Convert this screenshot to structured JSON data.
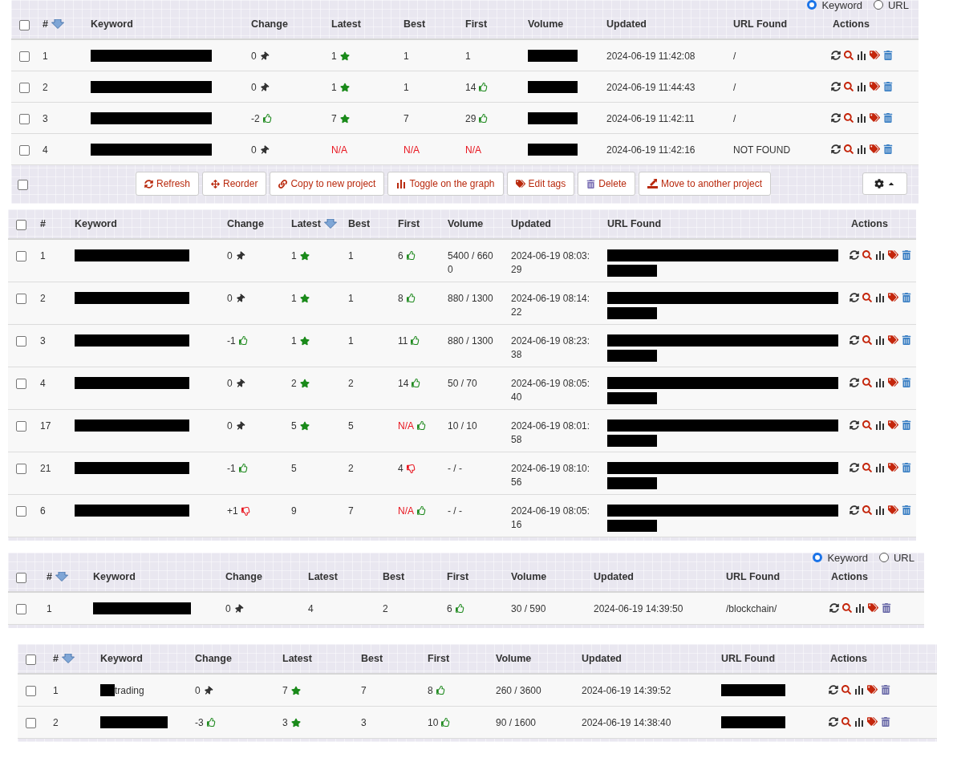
{
  "panels": [
    {
      "search_mode": [
        {
          "label": "Keyword",
          "selected": true
        },
        {
          "label": "URL",
          "selected": false
        }
      ],
      "all_checked": false,
      "columns": [
        {
          "label": "#",
          "sorted": true
        },
        {
          "label": "Keyword",
          "sorted": false
        },
        {
          "label": "Change",
          "sorted": false
        },
        {
          "label": "Latest",
          "sorted": false
        },
        {
          "label": "Best",
          "sorted": false
        },
        {
          "label": "First",
          "sorted": false
        },
        {
          "label": "Volume",
          "sorted": false
        },
        {
          "label": "Updated",
          "sorted": false
        },
        {
          "label": "URL Found",
          "sorted": false
        },
        {
          "label": "Actions",
          "sorted": false
        }
      ],
      "rows": [
        {
          "checked": false,
          "cells": [
            {
              "text": "1"
            },
            {
              "redacted": true
            },
            {
              "text": "0",
              "kind": "pin"
            },
            {
              "text": "1",
              "kind": "star"
            },
            {
              "text": "1"
            },
            {
              "text": "1"
            },
            {
              "redacted": true
            },
            {
              "text": "2024-06-19 11:42:08"
            },
            {
              "text": "/"
            }
          ]
        },
        {
          "checked": false,
          "cells": [
            {
              "text": "2"
            },
            {
              "redacted": true
            },
            {
              "text": "0",
              "kind": "pin"
            },
            {
              "text": "1",
              "kind": "star"
            },
            {
              "text": "1"
            },
            {
              "text": "14",
              "kind": "up"
            },
            {
              "redacted": true
            },
            {
              "text": "2024-06-19 11:44:43"
            },
            {
              "text": "/"
            }
          ]
        },
        {
          "checked": false,
          "cells": [
            {
              "text": "3"
            },
            {
              "redacted": true
            },
            {
              "text": "-2",
              "kind": "up"
            },
            {
              "text": "7",
              "kind": "star"
            },
            {
              "text": "7"
            },
            {
              "text": "29",
              "kind": "up"
            },
            {
              "redacted": true
            },
            {
              "text": "2024-06-19 11:42:11"
            },
            {
              "text": "/"
            }
          ]
        },
        {
          "checked": false,
          "cells": [
            {
              "text": "4"
            },
            {
              "redacted": true
            },
            {
              "text": "0",
              "kind": "pin"
            },
            {
              "text": "N/A",
              "missing": true
            },
            {
              "text": "N/A",
              "missing": true
            },
            {
              "text": "N/A",
              "missing": true
            },
            {
              "redacted": true
            },
            {
              "text": "2024-06-19 11:42:16"
            },
            {
              "text": "NOT FOUND"
            }
          ]
        }
      ],
      "toolbar": {
        "checked": false,
        "buttons": [
          {
            "label": "Refresh",
            "kind": "refresh"
          },
          {
            "label": "Reorder",
            "kind": "move"
          },
          {
            "label": "Copy to new project",
            "kind": "link"
          },
          {
            "label": "Toggle on the graph",
            "kind": "chart"
          },
          {
            "label": "Edit tags",
            "kind": "tags"
          },
          {
            "label": "Delete",
            "kind": "trash"
          },
          {
            "label": "Move to another project",
            "kind": "export"
          }
        ]
      }
    },
    {
      "all_checked": false,
      "columns": [
        {
          "label": "#",
          "sorted": false
        },
        {
          "label": "Keyword",
          "sorted": false
        },
        {
          "label": "Change",
          "sorted": false
        },
        {
          "label": "Latest",
          "sorted": true
        },
        {
          "label": "Best",
          "sorted": false
        },
        {
          "label": "First",
          "sorted": false
        },
        {
          "label": "Volume",
          "sorted": false
        },
        {
          "label": "Updated",
          "sorted": false
        },
        {
          "label": "URL Found",
          "sorted": false
        },
        {
          "label": "Actions",
          "sorted": false
        }
      ],
      "rows": [
        {
          "checked": false,
          "cells": [
            {
              "text": "1"
            },
            {
              "redacted": true
            },
            {
              "text": "0",
              "kind": "pin"
            },
            {
              "text": "1",
              "kind": "star"
            },
            {
              "text": "1"
            },
            {
              "text": "6",
              "kind": "up"
            },
            {
              "text": "5400 / 6600"
            },
            {
              "text": "2024-06-19 08:03:29"
            },
            {
              "redacted": true,
              "wrapped": true
            }
          ]
        },
        {
          "checked": false,
          "cells": [
            {
              "text": "2"
            },
            {
              "redacted": true
            },
            {
              "text": "0",
              "kind": "pin"
            },
            {
              "text": "1",
              "kind": "star"
            },
            {
              "text": "1"
            },
            {
              "text": "8",
              "kind": "up"
            },
            {
              "text": "880 / 1300"
            },
            {
              "text": "2024-06-19 08:14:22"
            },
            {
              "redacted": true,
              "wrapped": true
            }
          ]
        },
        {
          "checked": false,
          "cells": [
            {
              "text": "3"
            },
            {
              "redacted": true
            },
            {
              "text": "-1",
              "kind": "up"
            },
            {
              "text": "1",
              "kind": "star"
            },
            {
              "text": "1"
            },
            {
              "text": "11",
              "kind": "up"
            },
            {
              "text": "880 / 1300"
            },
            {
              "text": "2024-06-19 08:23:38"
            },
            {
              "redacted": true,
              "wrapped": true
            }
          ]
        },
        {
          "checked": false,
          "cells": [
            {
              "text": "4"
            },
            {
              "redacted": true
            },
            {
              "text": "0",
              "kind": "pin"
            },
            {
              "text": "2",
              "kind": "star"
            },
            {
              "text": "2"
            },
            {
              "text": "14",
              "kind": "up"
            },
            {
              "text": "50 / 70"
            },
            {
              "text": "2024-06-19 08:05:40"
            },
            {
              "redacted": true,
              "wrapped": true
            }
          ]
        },
        {
          "checked": false,
          "cells": [
            {
              "text": "17"
            },
            {
              "redacted": true
            },
            {
              "text": "0",
              "kind": "pin"
            },
            {
              "text": "5",
              "kind": "star"
            },
            {
              "text": "5"
            },
            {
              "text": "N/A",
              "missing": true,
              "kind": "up"
            },
            {
              "text": "10 / 10"
            },
            {
              "text": "2024-06-19 08:01:58"
            },
            {
              "redacted": true,
              "wrapped": true
            }
          ]
        },
        {
          "checked": false,
          "cells": [
            {
              "text": "21"
            },
            {
              "redacted": true
            },
            {
              "text": "-1",
              "kind": "up"
            },
            {
              "text": "5"
            },
            {
              "text": "2"
            },
            {
              "text": "4",
              "kind": "down"
            },
            {
              "text": "- / -"
            },
            {
              "text": "2024-06-19 08:10:56"
            },
            {
              "redacted": true,
              "wrapped": true
            }
          ]
        },
        {
          "checked": false,
          "cells": [
            {
              "text": "6"
            },
            {
              "redacted": true
            },
            {
              "text": "+1",
              "kind": "down"
            },
            {
              "text": "9"
            },
            {
              "text": "7"
            },
            {
              "text": "N/A",
              "missing": true,
              "kind": "up"
            },
            {
              "text": "- / -"
            },
            {
              "text": "2024-06-19 08:05:16"
            },
            {
              "redacted": true,
              "wrapped": true
            }
          ]
        }
      ]
    },
    {
      "search_mode": [
        {
          "label": "Keyword",
          "selected": true
        },
        {
          "label": "URL",
          "selected": false
        }
      ],
      "all_checked": false,
      "columns": [
        {
          "label": "#",
          "sorted": true
        },
        {
          "label": "Keyword",
          "sorted": false
        },
        {
          "label": "Change",
          "sorted": false
        },
        {
          "label": "Latest",
          "sorted": false
        },
        {
          "label": "Best",
          "sorted": false
        },
        {
          "label": "First",
          "sorted": false
        },
        {
          "label": "Volume",
          "sorted": false
        },
        {
          "label": "Updated",
          "sorted": false
        },
        {
          "label": "URL Found",
          "sorted": false
        },
        {
          "label": "Actions",
          "sorted": false
        }
      ],
      "rows": [
        {
          "checked": false,
          "cells": [
            {
              "text": "1"
            },
            {
              "redacted": true
            },
            {
              "text": "0",
              "kind": "pin"
            },
            {
              "text": "4"
            },
            {
              "text": "2"
            },
            {
              "text": "6",
              "kind": "up"
            },
            {
              "text": "30 / 590"
            },
            {
              "text": "2024-06-19 14:39:50"
            },
            {
              "text": "/blockchain/"
            }
          ]
        }
      ]
    },
    {
      "all_checked": false,
      "columns": [
        {
          "label": "#",
          "sorted": true
        },
        {
          "label": "Keyword",
          "sorted": false
        },
        {
          "label": "Change",
          "sorted": false
        },
        {
          "label": "Latest",
          "sorted": false
        },
        {
          "label": "Best",
          "sorted": false
        },
        {
          "label": "First",
          "sorted": false
        },
        {
          "label": "Volume",
          "sorted": false
        },
        {
          "label": "Updated",
          "sorted": false
        },
        {
          "label": "URL Found",
          "sorted": false
        },
        {
          "label": "Actions",
          "sorted": false
        }
      ],
      "rows": [
        {
          "checked": false,
          "cells": [
            {
              "text": "1"
            },
            {
              "redacted": true,
              "text": "trading"
            },
            {
              "text": "0",
              "kind": "pin"
            },
            {
              "text": "7",
              "kind": "star"
            },
            {
              "text": "7"
            },
            {
              "text": "8",
              "kind": "up"
            },
            {
              "text": "260 / 3600"
            },
            {
              "text": "2024-06-19 14:39:52"
            },
            {
              "redacted": true
            }
          ]
        },
        {
          "checked": false,
          "cells": [
            {
              "text": "2"
            },
            {
              "redacted": true
            },
            {
              "text": "-3",
              "kind": "up"
            },
            {
              "text": "3",
              "kind": "star"
            },
            {
              "text": "3"
            },
            {
              "text": "10",
              "kind": "up"
            },
            {
              "text": "90 / 1600"
            },
            {
              "text": "2024-06-19 14:38:40"
            },
            {
              "redacted": true
            }
          ]
        }
      ]
    }
  ]
}
